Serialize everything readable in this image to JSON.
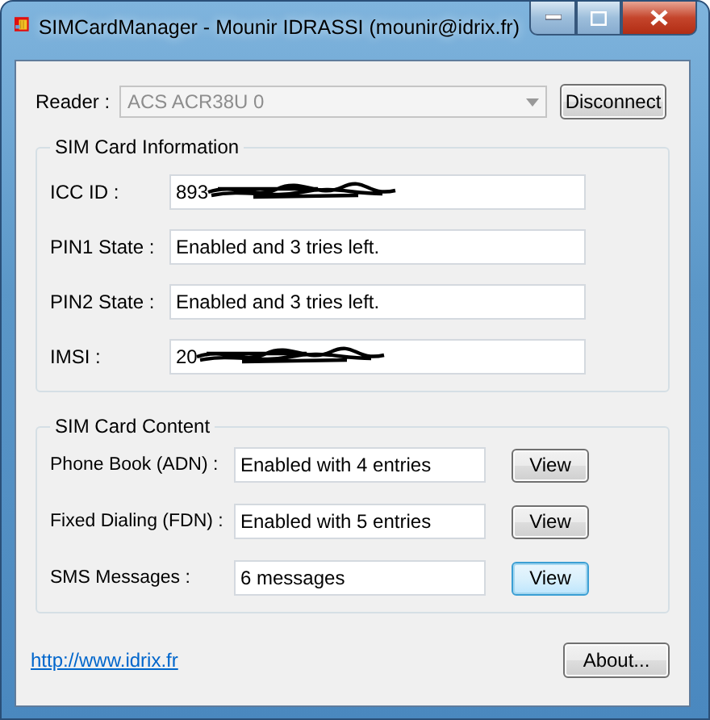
{
  "window": {
    "title": "SIMCardManager - Mounir IDRASSI (mounir@idrix.fr)"
  },
  "reader": {
    "label": "Reader :",
    "value": "ACS ACR38U 0",
    "disabled": true,
    "button": "Disconnect"
  },
  "sim_info": {
    "title": "SIM Card Information",
    "fields": [
      {
        "label": "ICC ID :",
        "value": "893",
        "redacted": true
      },
      {
        "label": "PIN1 State :",
        "value": "Enabled and 3 tries left.",
        "redacted": false
      },
      {
        "label": "PIN2 State :",
        "value": "Enabled and 3 tries left.",
        "redacted": false
      },
      {
        "label": "IMSI :",
        "value": "20",
        "redacted": true
      }
    ]
  },
  "sim_content": {
    "title": "SIM Card Content",
    "rows": [
      {
        "label": "Phone Book (ADN) :",
        "value": "Enabled with 4 entries",
        "button": "View",
        "focused": false
      },
      {
        "label": "Fixed Dialing (FDN) :",
        "value": "Enabled with 5 entries",
        "button": "View",
        "focused": false
      },
      {
        "label": "SMS Messages :",
        "value": "6 messages",
        "button": "View",
        "focused": true
      }
    ]
  },
  "footer": {
    "link": "http://www.idrix.fr",
    "button": "About..."
  }
}
